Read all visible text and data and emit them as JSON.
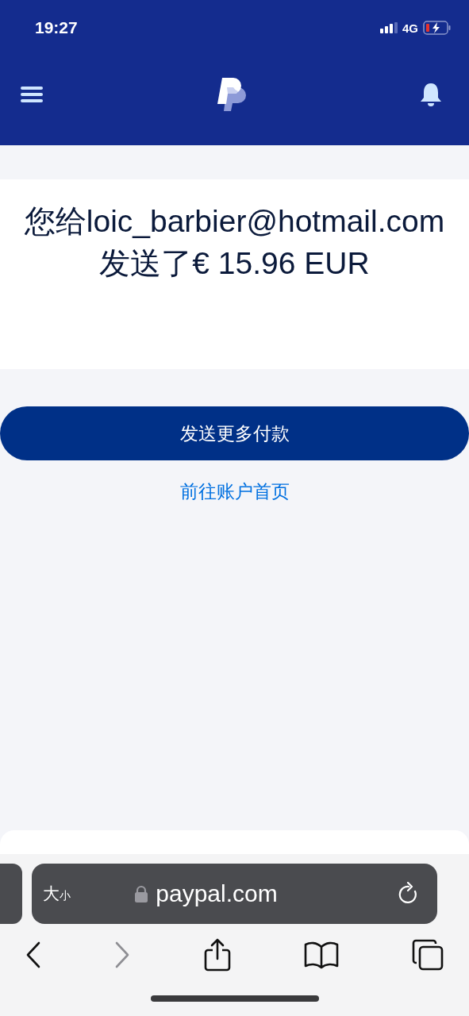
{
  "status_bar": {
    "time": "19:27",
    "network": "4G"
  },
  "confirmation": {
    "message": "您给loic_barbier@hotmail.com发送了€ 15.96 EUR"
  },
  "primary_button": "发送更多付款",
  "secondary_link": "前往账户首页",
  "browser": {
    "text_size": {
      "large": "大",
      "small": "小"
    },
    "url": "paypal.com",
    "nav": [
      {
        "kind": "back",
        "disabled": false
      },
      {
        "kind": "forward",
        "disabled": true
      },
      {
        "kind": "share",
        "disabled": false
      },
      {
        "kind": "bookmarks",
        "disabled": false
      },
      {
        "kind": "tabs",
        "disabled": false
      }
    ]
  }
}
